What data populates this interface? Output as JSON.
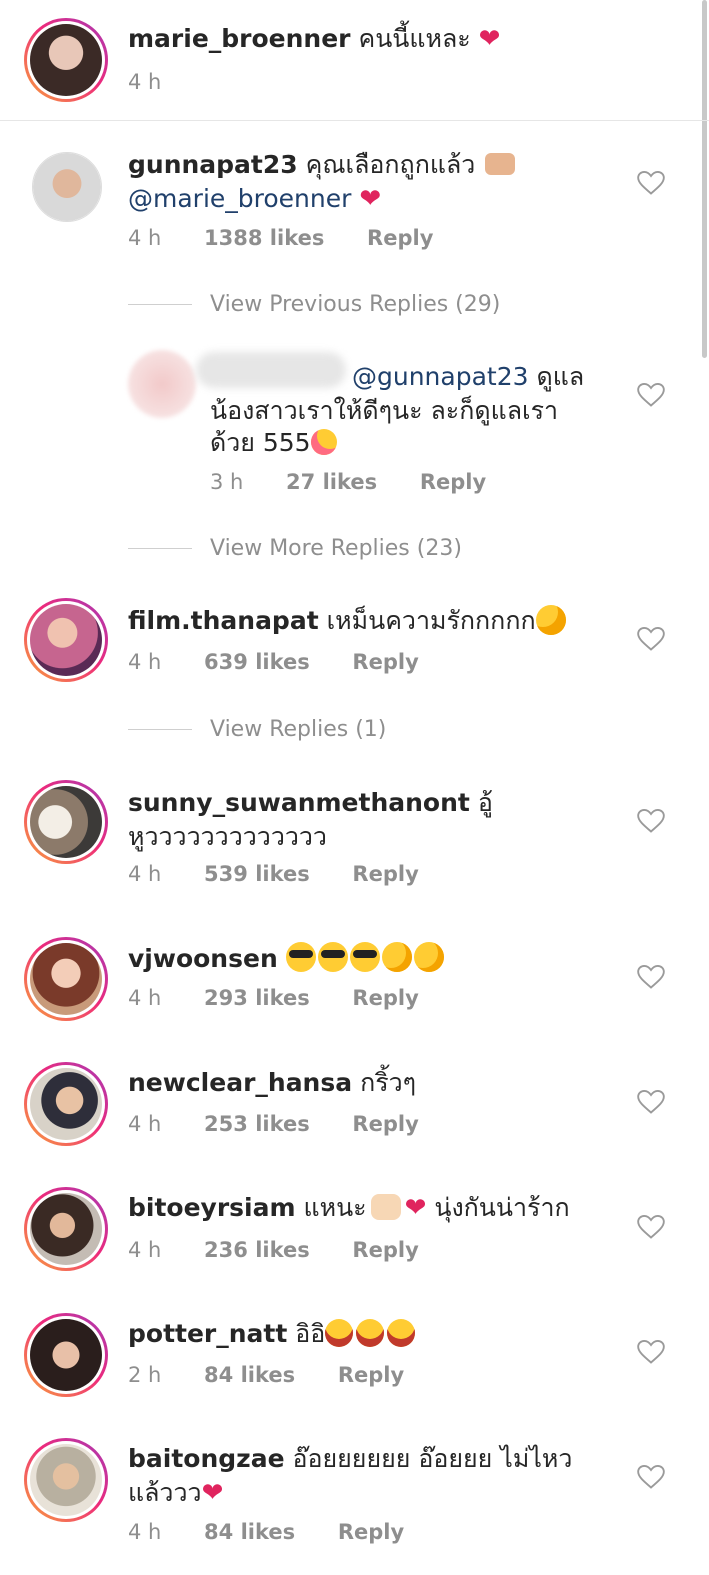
{
  "caption": {
    "username": "marie_broenner",
    "text": "คนนี้แหละ",
    "emoji": "❤",
    "time": "4 h"
  },
  "comments": [
    {
      "username": "gunnapat23",
      "text": "คุณเลือกถูกแล้ว",
      "mention": "@marie_broenner",
      "time": "4 h",
      "likes": "1388 likes",
      "reply": "Reply"
    },
    {
      "username": "film.thanapat",
      "text": "เหม็นความรักกกกก",
      "time": "4 h",
      "likes": "639 likes",
      "reply": "Reply"
    },
    {
      "username": "sunny_suwanmethanont",
      "text": "อู้",
      "text2": "หูววววววววววววว",
      "time": "4 h",
      "likes": "539 likes",
      "reply": "Reply"
    },
    {
      "username": "vjwoonsen",
      "text": "",
      "time": "4 h",
      "likes": "293 likes",
      "reply": "Reply"
    },
    {
      "username": "newclear_hansa",
      "text": "กริ้วๆ",
      "time": "4 h",
      "likes": "253 likes",
      "reply": "Reply"
    },
    {
      "username": "bitoeyrsiam",
      "text": "แหนะ",
      "text2": "นุ่งกันน่าร้าก",
      "time": "4 h",
      "likes": "236 likes",
      "reply": "Reply"
    },
    {
      "username": "potter_natt",
      "text": "อิอิ",
      "time": "2 h",
      "likes": "84 likes",
      "reply": "Reply"
    },
    {
      "username": "baitongzae",
      "text": "อ๊อยยยยยย อ๊อยยย ไม่ไหว",
      "text2": "แล้ววว",
      "time": "4 h",
      "likes": "84 likes",
      "reply": "Reply"
    }
  ],
  "reply": {
    "mention": "@gunnapat23",
    "line1": "ดูแล",
    "line2": "น้องสาวเราให้ดีๆนะ ละก็ดูแลเรา",
    "line3": "ด้วย 555",
    "time": "3 h",
    "likes": "27 likes",
    "reply": "Reply"
  },
  "threads": {
    "previous": "View Previous Replies (29)",
    "more": "View More Replies (23)",
    "view": "View Replies (1)"
  },
  "colors": {
    "mention": "#20406b",
    "meta": "#8e8e8e",
    "heart": "#e0245e"
  },
  "icons": {
    "like": "heart-outline-icon",
    "love": "red-heart-icon"
  }
}
